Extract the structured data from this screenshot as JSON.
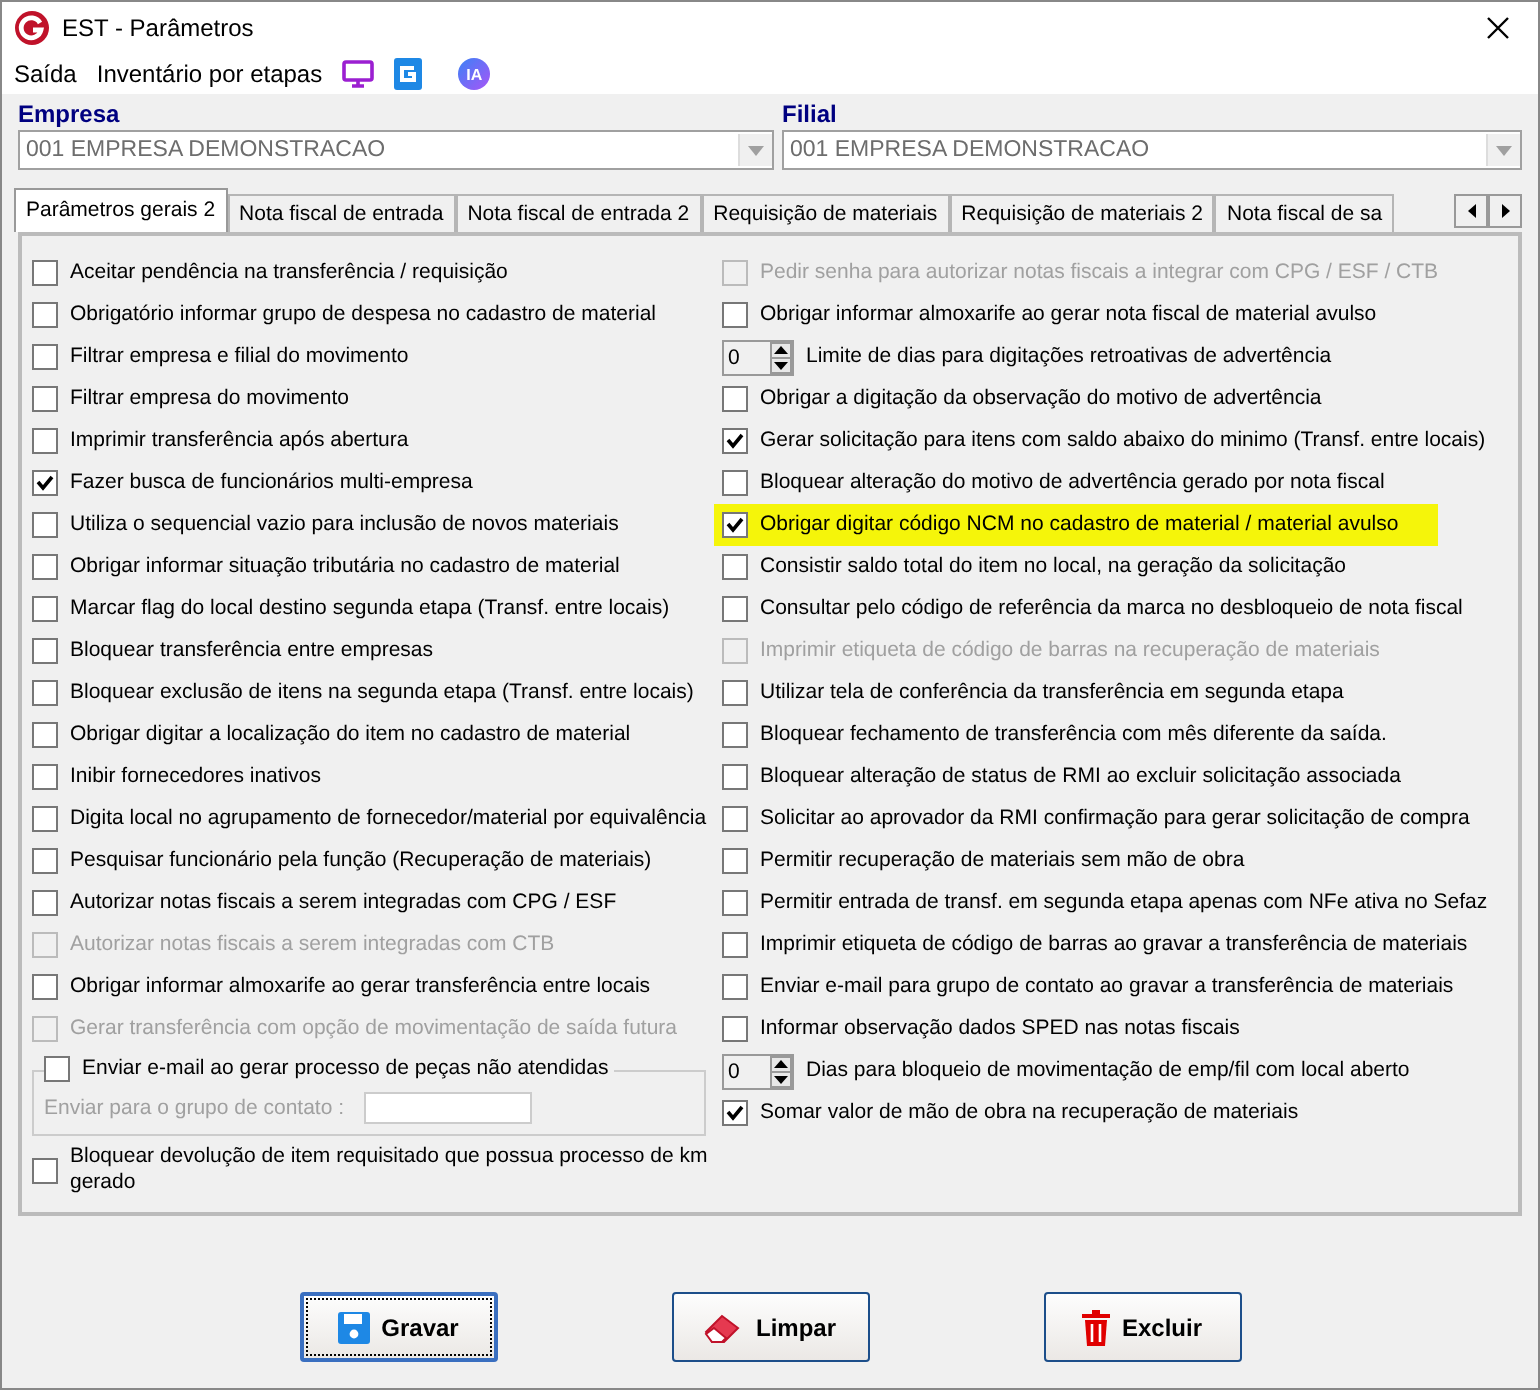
{
  "window": {
    "title": "EST - Parâmetros"
  },
  "menu": {
    "items": [
      "Saída",
      "Inventário por etapas"
    ],
    "badge": "IA"
  },
  "selectors": [
    {
      "label": "Empresa",
      "value": "001 EMPRESA DEMONSTRACAO"
    },
    {
      "label": "Filial",
      "value": "001 EMPRESA DEMONSTRACAO"
    }
  ],
  "tabs": [
    {
      "label": "Parâmetros gerais 2",
      "selected": true
    },
    {
      "label": "Nota fiscal de entrada",
      "selected": false
    },
    {
      "label": "Nota fiscal de entrada 2",
      "selected": false
    },
    {
      "label": "Requisição de materiais",
      "selected": false
    },
    {
      "label": "Requisição de materiais 2",
      "selected": false
    },
    {
      "label": "Nota fiscal de sa",
      "selected": false
    }
  ],
  "left_options": [
    {
      "kind": "checkbox",
      "label": "Aceitar pendência na transferência / requisição",
      "checked": false,
      "disabled": false
    },
    {
      "kind": "checkbox",
      "label": "Obrigatório informar grupo de despesa no cadastro de material",
      "checked": false,
      "disabled": false
    },
    {
      "kind": "checkbox",
      "label": "Filtrar empresa e filial do movimento",
      "checked": false,
      "disabled": false
    },
    {
      "kind": "checkbox",
      "label": "Filtrar empresa do movimento",
      "checked": false,
      "disabled": false
    },
    {
      "kind": "checkbox",
      "label": "Imprimir transferência após abertura",
      "checked": false,
      "disabled": false
    },
    {
      "kind": "checkbox",
      "label": "Fazer busca de funcionários multi-empresa",
      "checked": true,
      "disabled": false
    },
    {
      "kind": "checkbox",
      "label": "Utiliza o sequencial vazio para inclusão de novos materiais",
      "checked": false,
      "disabled": false
    },
    {
      "kind": "checkbox",
      "label": "Obrigar informar situação tributária no cadastro de material",
      "checked": false,
      "disabled": false
    },
    {
      "kind": "checkbox",
      "label": "Marcar flag do local destino segunda etapa (Transf. entre locais)",
      "checked": false,
      "disabled": false
    },
    {
      "kind": "checkbox",
      "label": "Bloquear transferência entre empresas",
      "checked": false,
      "disabled": false
    },
    {
      "kind": "checkbox",
      "label": "Bloquear exclusão de itens na segunda etapa (Transf. entre locais)",
      "checked": false,
      "disabled": false
    },
    {
      "kind": "checkbox",
      "label": "Obrigar digitar a localização do item no cadastro de material",
      "checked": false,
      "disabled": false
    },
    {
      "kind": "checkbox",
      "label": "Inibir fornecedores inativos",
      "checked": false,
      "disabled": false
    },
    {
      "kind": "checkbox",
      "label": "Digita local no agrupamento de fornecedor/material por equivalência",
      "checked": false,
      "disabled": false
    },
    {
      "kind": "checkbox",
      "label": "Pesquisar funcionário pela função (Recuperação de materiais)",
      "checked": false,
      "disabled": false
    },
    {
      "kind": "checkbox",
      "label": "Autorizar notas fiscais a serem integradas com CPG / ESF",
      "checked": false,
      "disabled": false
    },
    {
      "kind": "checkbox",
      "label": "Autorizar notas fiscais a serem integradas com CTB",
      "checked": false,
      "disabled": true
    },
    {
      "kind": "checkbox",
      "label": "Obrigar informar almoxarife ao gerar transferência entre locais",
      "checked": false,
      "disabled": false
    },
    {
      "kind": "checkbox",
      "label": "Gerar transferência com opção de movimentação de saída futura",
      "checked": false,
      "disabled": true
    },
    {
      "kind": "group",
      "label": "Enviar e-mail ao gerar processo de peças não atendidas",
      "checked": false,
      "disabled": false,
      "field_label": "Enviar para o grupo de contato :"
    },
    {
      "kind": "checkbox",
      "label": "Bloquear devolução de item requisitado que possua processo de km gerado",
      "checked": false,
      "disabled": false
    }
  ],
  "right_options": [
    {
      "kind": "checkbox",
      "label": "Pedir senha para autorizar notas fiscais a integrar com CPG / ESF / CTB",
      "checked": false,
      "disabled": true,
      "highlighted": false
    },
    {
      "kind": "checkbox",
      "label": "Obrigar informar almoxarife ao gerar nota fiscal de material avulso",
      "checked": false,
      "disabled": false,
      "highlighted": false
    },
    {
      "kind": "spinner",
      "value": "0",
      "label": "Limite de dias para digitações retroativas de advertência"
    },
    {
      "kind": "checkbox",
      "label": "Obrigar a digitação da observação do motivo de advertência",
      "checked": false,
      "disabled": false,
      "highlighted": false
    },
    {
      "kind": "checkbox",
      "label": "Gerar solicitação para itens com saldo abaixo do minimo (Transf. entre locais)",
      "checked": true,
      "disabled": false,
      "highlighted": false
    },
    {
      "kind": "checkbox",
      "label": "Bloquear alteração do motivo de advertência gerado por nota fiscal",
      "checked": false,
      "disabled": false,
      "highlighted": false
    },
    {
      "kind": "checkbox",
      "label": "Obrigar digitar código NCM no cadastro de material / material avulso",
      "checked": true,
      "disabled": false,
      "highlighted": true
    },
    {
      "kind": "checkbox",
      "label": "Consistir saldo total do item no local, na geração da solicitação",
      "checked": false,
      "disabled": false,
      "highlighted": false
    },
    {
      "kind": "checkbox",
      "label": "Consultar pelo código de referência da marca no desbloqueio de nota fiscal",
      "checked": false,
      "disabled": false,
      "highlighted": false
    },
    {
      "kind": "checkbox",
      "label": "Imprimir etiqueta de código de barras na recuperação de materiais",
      "checked": false,
      "disabled": true,
      "highlighted": false
    },
    {
      "kind": "checkbox",
      "label": "Utilizar tela de conferência da transferência em segunda etapa",
      "checked": false,
      "disabled": false,
      "highlighted": false
    },
    {
      "kind": "checkbox",
      "label": "Bloquear fechamento de transferência com mês diferente da saída.",
      "checked": false,
      "disabled": false,
      "highlighted": false
    },
    {
      "kind": "checkbox",
      "label": "Bloquear alteração de status de RMI ao excluir solicitação associada",
      "checked": false,
      "disabled": false,
      "highlighted": false
    },
    {
      "kind": "checkbox",
      "label": "Solicitar ao aprovador da RMI confirmação para gerar solicitação de compra",
      "checked": false,
      "disabled": false,
      "highlighted": false
    },
    {
      "kind": "checkbox",
      "label": "Permitir recuperação de materiais sem mão de obra",
      "checked": false,
      "disabled": false,
      "highlighted": false
    },
    {
      "kind": "checkbox",
      "label": "Permitir entrada de transf. em segunda etapa apenas com NFe ativa no Sefaz",
      "checked": false,
      "disabled": false,
      "highlighted": false
    },
    {
      "kind": "checkbox",
      "label": "Imprimir etiqueta de código de barras ao gravar a transferência de materiais",
      "checked": false,
      "disabled": false,
      "highlighted": false
    },
    {
      "kind": "checkbox",
      "label": "Enviar e-mail para grupo de contato ao gravar a transferência de materiais",
      "checked": false,
      "disabled": false,
      "highlighted": false
    },
    {
      "kind": "checkbox",
      "label": "Informar observação dados SPED nas notas fiscais",
      "checked": false,
      "disabled": false,
      "highlighted": false
    },
    {
      "kind": "spinner",
      "value": "0",
      "label": "Dias para bloqueio de movimentação de emp/fil com local aberto"
    },
    {
      "kind": "checkbox",
      "label": "Somar valor de mão de obra na recuperação de materiais",
      "checked": true,
      "disabled": false,
      "highlighted": false
    }
  ],
  "buttons": [
    {
      "label": "Gravar",
      "kind": "save",
      "focused": true
    },
    {
      "label": "Limpar",
      "kind": "eraser",
      "focused": false
    },
    {
      "label": "Excluir",
      "kind": "trash",
      "focused": false
    }
  ]
}
